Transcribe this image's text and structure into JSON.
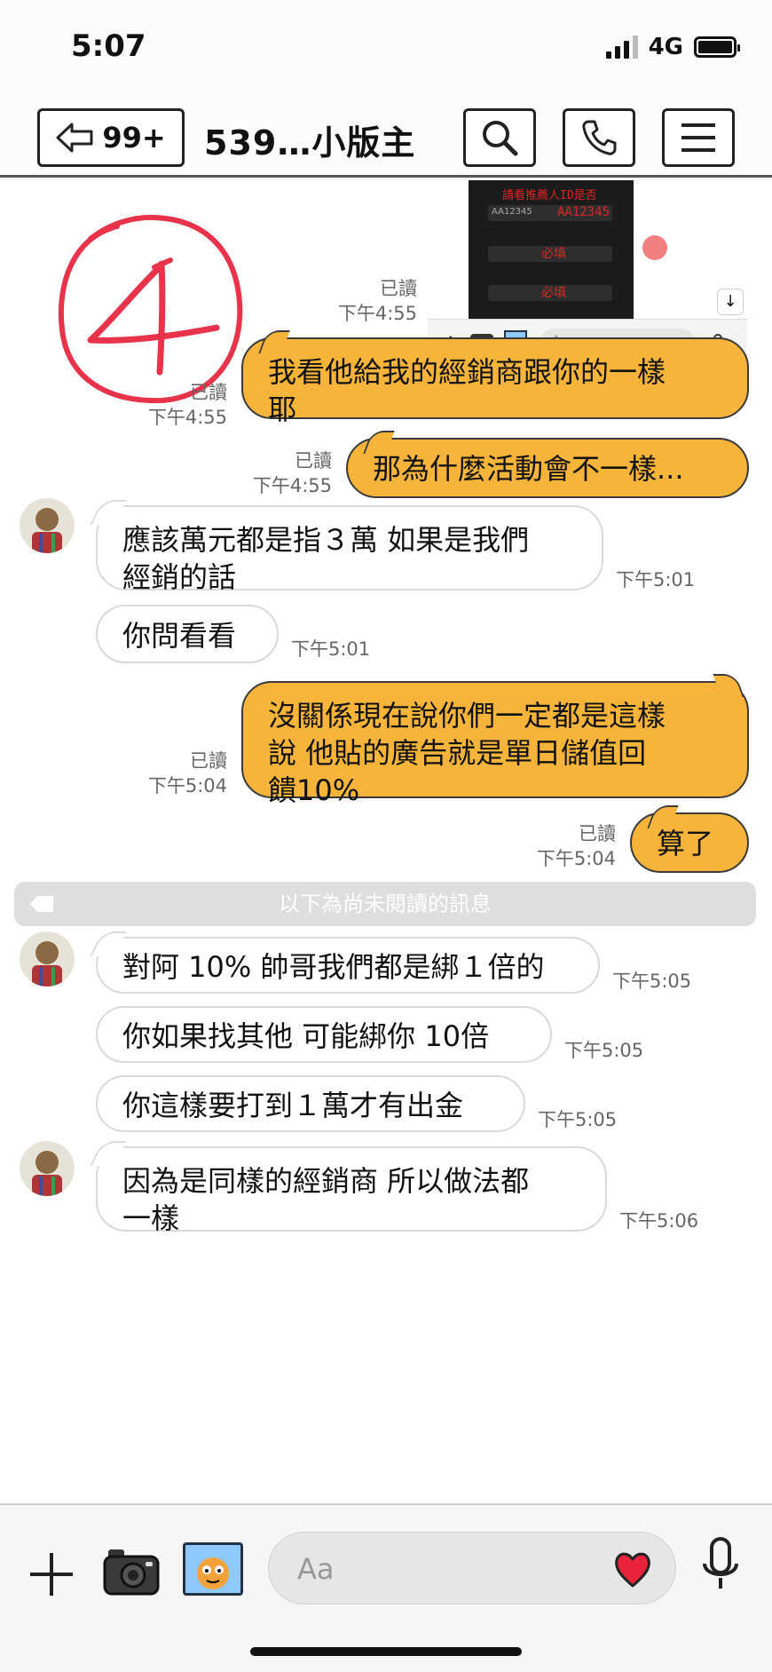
{
  "status_bar": {
    "time": "5:07",
    "network": "4G"
  },
  "header": {
    "back_count": "99+",
    "title": "539…小版主"
  },
  "preview": {
    "red_line_1": "請看推薦人ID是否",
    "red_code": "AA12345",
    "placeholder_id": "AA12345",
    "required_1": "必填",
    "required_2": "必填",
    "input_placeholder": "Aa"
  },
  "annotation": "4",
  "messages": [
    {
      "dir": "out",
      "read": "已讀",
      "time": "下午4:55"
    },
    {
      "dir": "out",
      "read": "已讀",
      "time": "下午4:55",
      "lines": [
        "我看他給我的經銷商跟你的一樣",
        "耶"
      ]
    },
    {
      "dir": "out",
      "read": "已讀",
      "time": "下午4:55",
      "lines": [
        "那為什麼活動會不一樣..."
      ]
    },
    {
      "dir": "in",
      "time": "下午5:01",
      "lines": [
        "應該萬元都是指３萬 如果是我們",
        "經銷的話"
      ]
    },
    {
      "dir": "in",
      "time": "下午5:01",
      "lines": [
        "你問看看"
      ]
    },
    {
      "dir": "out",
      "read": "已讀",
      "time": "下午5:04",
      "lines": [
        "沒關係現在說你們一定都是這樣",
        "說 他貼的廣告就是單日儲值回",
        "饋10%"
      ]
    },
    {
      "dir": "out",
      "read": "已讀",
      "time": "下午5:04",
      "lines": [
        "算了"
      ]
    },
    {
      "dir": "in",
      "time": "下午5:05",
      "lines": [
        "對阿 10% 帥哥我們都是綁１倍的"
      ]
    },
    {
      "dir": "in",
      "time": "下午5:05",
      "lines": [
        "你如果找其他 可能綁你 10倍"
      ]
    },
    {
      "dir": "in",
      "time": "下午5:05",
      "lines": [
        "你這樣要打到１萬才有出金"
      ]
    },
    {
      "dir": "in",
      "time": "下午5:06",
      "lines": [
        "因為是同樣的經銷商 所以做法都",
        "一樣"
      ]
    }
  ],
  "unread_divider": "以下為尚未閱讀的訊息",
  "input_bar": {
    "placeholder": "Aa"
  },
  "colors": {
    "outgoing": "#f6b43a",
    "annotation": "#e8334a"
  }
}
